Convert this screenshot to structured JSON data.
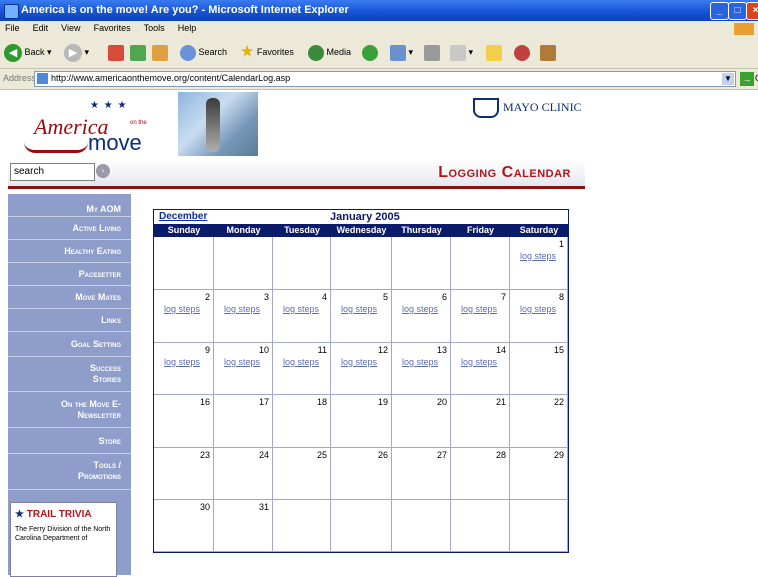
{
  "window": {
    "title": "America is on the move! Are you? - Microsoft Internet Explorer"
  },
  "menu": [
    "File",
    "Edit",
    "View",
    "Favorites",
    "Tools",
    "Help"
  ],
  "toolbar": {
    "back": "Back",
    "search": "Search",
    "favorites": "Favorites",
    "media": "Media"
  },
  "address": {
    "label": "Address",
    "url": "http://www.americaonthemove.org/content/CalendarLog.asp",
    "go": "Go"
  },
  "header": {
    "logo_top": "America",
    "logo_bottom": "move",
    "logo_small": "on the",
    "partner": "MAYO CLINIC"
  },
  "search": {
    "value": "search"
  },
  "page_title": "Logging Calendar",
  "nav": [
    "My AOM",
    "Active Living",
    "Healthy Eating",
    "Pacesetter",
    "Move Mates",
    "Links",
    "Goal Setting",
    "Success Stories",
    "On the Move E-Newsletter",
    "Store",
    "Tools / Promotions"
  ],
  "trivia": {
    "title": "TRAIL TRIVIA",
    "text": "The Ferry Division of the North Carolina Department of"
  },
  "calendar": {
    "prev_month": "December",
    "month": "January 2005",
    "days": [
      "Sunday",
      "Monday",
      "Tuesday",
      "Wednesday",
      "Thursday",
      "Friday",
      "Saturday"
    ],
    "log_label": "log steps",
    "weeks": [
      [
        "",
        "",
        "",
        "",
        "",
        "",
        "1"
      ],
      [
        "2",
        "3",
        "4",
        "5",
        "6",
        "7",
        "8"
      ],
      [
        "9",
        "10",
        "11",
        "12",
        "13",
        "14",
        "15"
      ],
      [
        "16",
        "17",
        "18",
        "19",
        "20",
        "21",
        "22"
      ],
      [
        "23",
        "24",
        "25",
        "26",
        "27",
        "28",
        "29"
      ],
      [
        "30",
        "31",
        "",
        "",
        "",
        "",
        ""
      ]
    ],
    "logged_days": [
      "1",
      "2",
      "3",
      "4",
      "5",
      "6",
      "7",
      "8",
      "9",
      "10",
      "11",
      "12",
      "13",
      "14"
    ]
  }
}
